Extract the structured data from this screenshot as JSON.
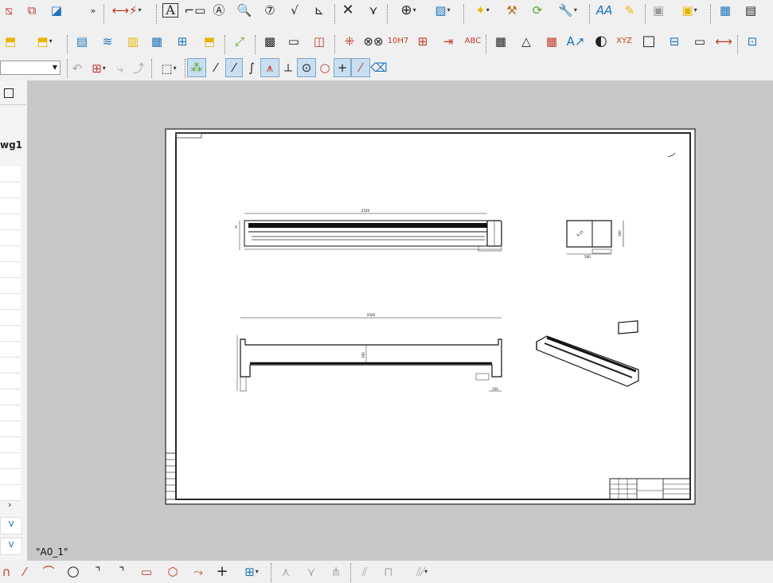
{
  "toolbar": {
    "overflow_glyph": "»",
    "text_tool_glyph": "A",
    "calc_glyph": "√",
    "label_10h7": "10H7",
    "label_abc": "ABC",
    "label_xyz": "XYZ",
    "label_aa": "A",
    "layer_dropdown_value": ""
  },
  "tree": {
    "drawing_name_fragment": "wg1"
  },
  "sheet": {
    "tab_label": "\"A0_1\""
  },
  "colors": {
    "accent_red": "#c0392b",
    "accent_yellow": "#e8b400",
    "accent_blue": "#1e73be",
    "sheet_background": "#ffffff",
    "workspace_background": "#c8c8c8"
  },
  "dimensions": {
    "top_view_length": "2520",
    "front_view_length": "2520",
    "front_view_height": "350",
    "side_width": "500",
    "side_height": "300",
    "detail_radius": "150"
  }
}
